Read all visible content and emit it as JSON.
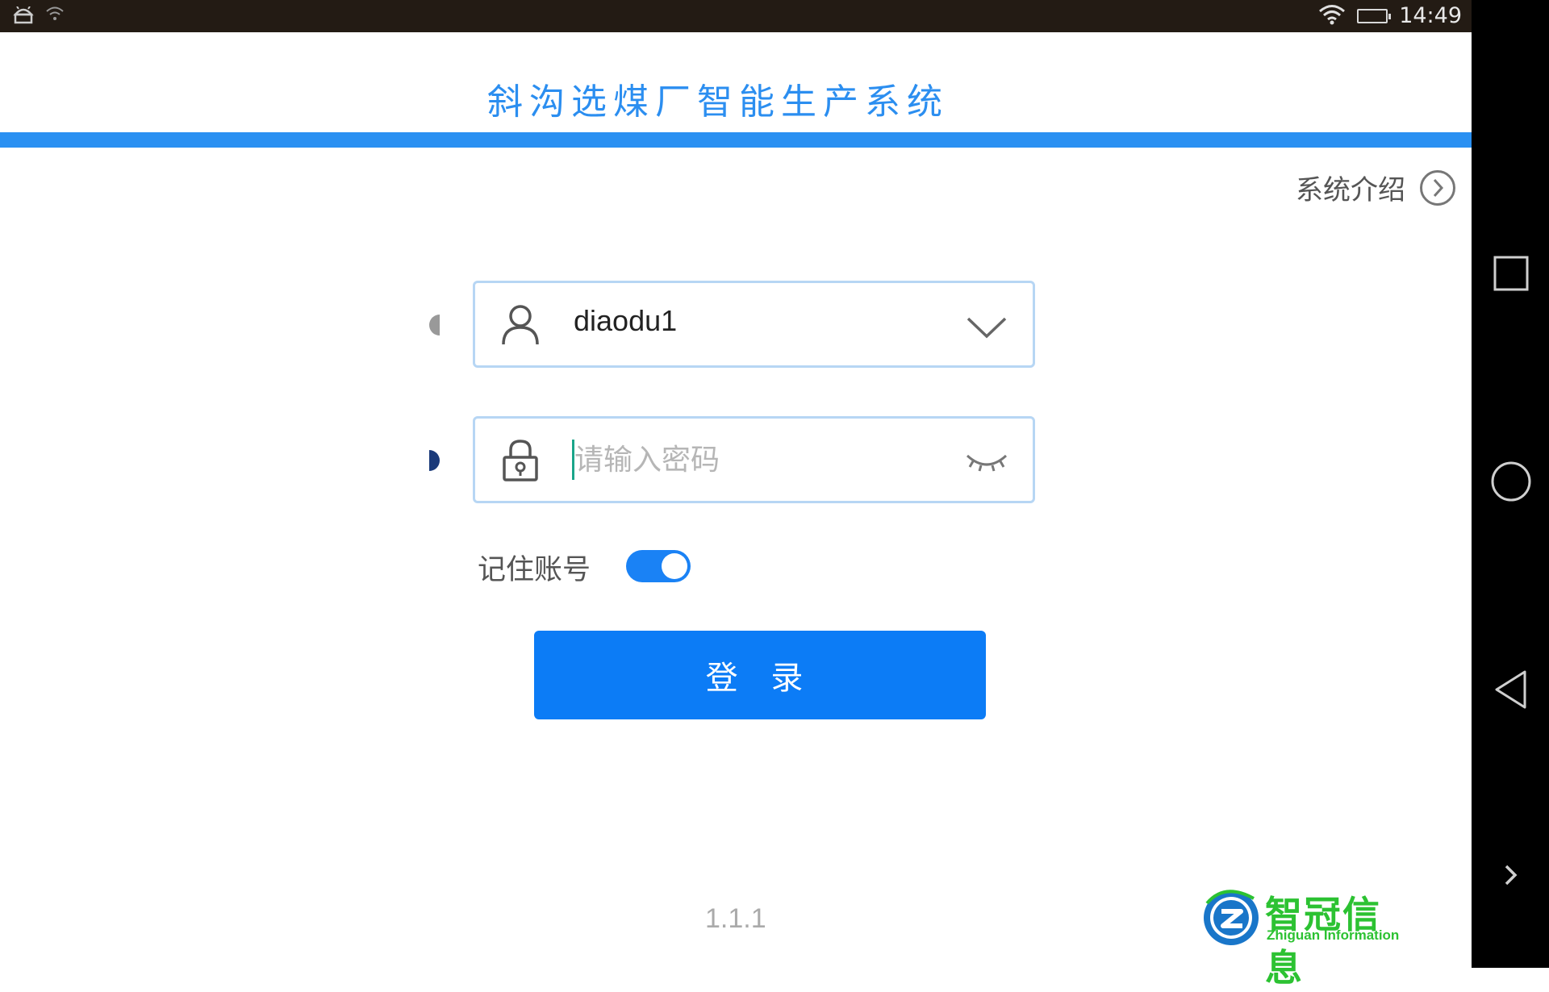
{
  "status_bar": {
    "time": "14:49",
    "left_icons": [
      "android-debug-icon",
      "wifi-question-icon"
    ],
    "right_icons": [
      "wifi-icon",
      "battery-charging-icon"
    ]
  },
  "app": {
    "title": "斜沟选煤厂智能生产系统",
    "accent_color": "#2a90f2"
  },
  "intro_link": {
    "label": "系统介绍",
    "icon": "chevron-right-circle-icon"
  },
  "login_form": {
    "username": {
      "value": "diaodu1",
      "icon": "user-icon",
      "trailing_icon": "chevron-down-icon"
    },
    "password": {
      "placeholder": "请输入密码",
      "value": "",
      "icon": "lock-icon",
      "trailing_icon": "eye-closed-icon"
    },
    "remember": {
      "label": "记住账号",
      "enabled": true
    },
    "submit_label": "登 录"
  },
  "version": "1.1.1",
  "brand": {
    "name_cn": "智冠信息",
    "name_en": "Zhiguan Information",
    "color": "#2cc232"
  },
  "nav_bar": {
    "buttons": [
      "recent-apps-icon",
      "home-icon",
      "back-icon",
      "expand-arrow-icon"
    ]
  }
}
